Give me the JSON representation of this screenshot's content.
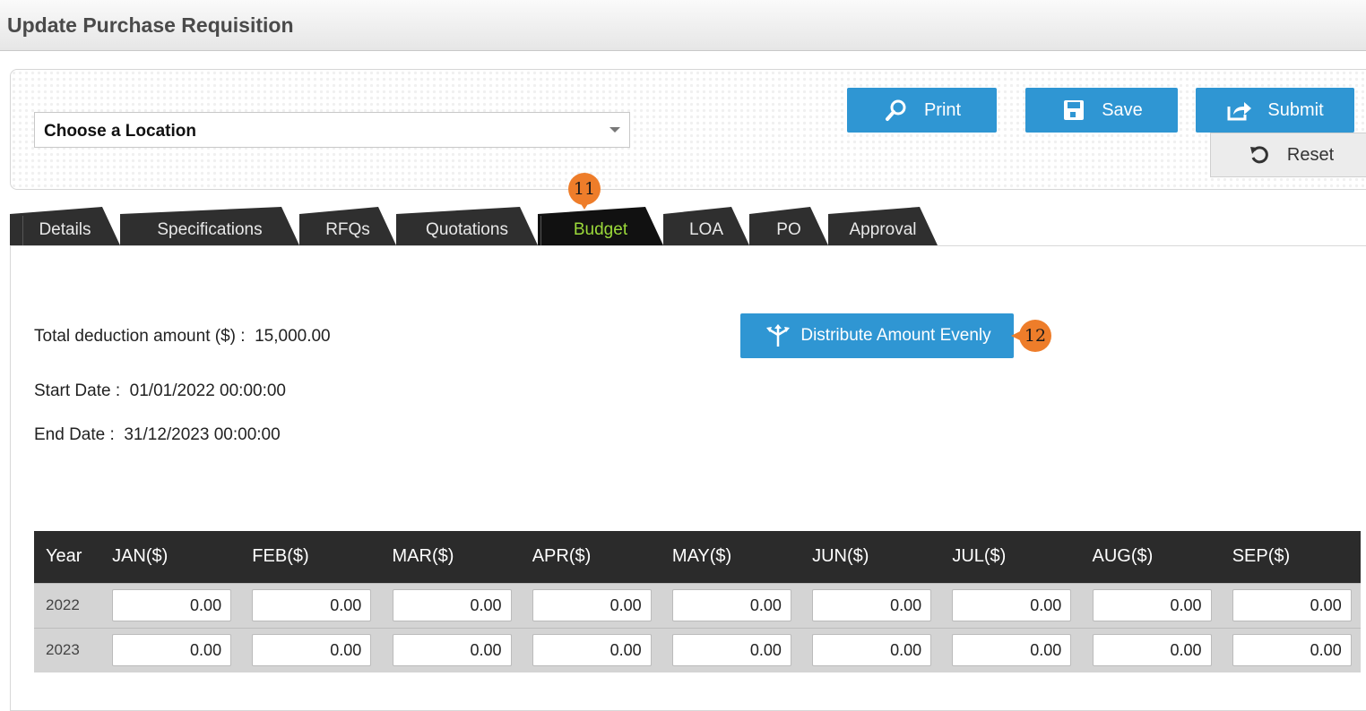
{
  "header": {
    "title": "Update Purchase Requisition"
  },
  "location": {
    "selected": "Choose a Location"
  },
  "actions": {
    "print": "Print",
    "save": "Save",
    "submit": "Submit",
    "reset": "Reset"
  },
  "tabs": [
    "Details",
    "Specifications",
    "RFQs",
    "Quotations",
    "Budget",
    "LOA",
    "PO",
    "Approval"
  ],
  "active_tab": "Budget",
  "callouts": {
    "budget_tab": "11",
    "distribute": "12"
  },
  "budget": {
    "total_label": "Total deduction amount ($) :",
    "total_value": "15,000.00",
    "start_label": "Start Date :",
    "start_value": "01/01/2022 00:00:00",
    "end_label": "End Date :",
    "end_value": "31/12/2023 00:00:00",
    "distribute_label": "Distribute Amount Evenly"
  },
  "table": {
    "year_header": "Year",
    "months": [
      "JAN($)",
      "FEB($)",
      "MAR($)",
      "APR($)",
      "MAY($)",
      "JUN($)",
      "JUL($)",
      "AUG($)",
      "SEP($)"
    ],
    "rows": [
      {
        "year": "2022",
        "values": [
          "0.00",
          "0.00",
          "0.00",
          "0.00",
          "0.00",
          "0.00",
          "0.00",
          "0.00",
          "0.00"
        ]
      },
      {
        "year": "2023",
        "values": [
          "0.00",
          "0.00",
          "0.00",
          "0.00",
          "0.00",
          "0.00",
          "0.00",
          "0.00",
          "0.00"
        ]
      }
    ]
  },
  "colors": {
    "primary_button": "#2f96d3",
    "active_tab_text": "#9bd93a",
    "callout": "#ee7d2a",
    "table_header": "#2b2b2b"
  }
}
